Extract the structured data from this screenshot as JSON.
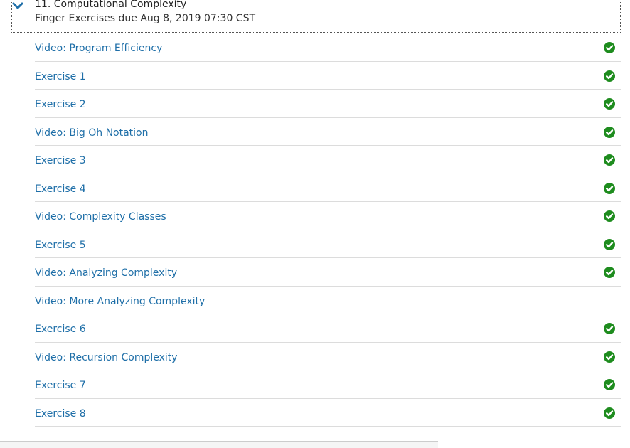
{
  "section": {
    "title": "11. Computational Complexity",
    "subtitle": "Finger Exercises due Aug 8, 2019 07:30 CST",
    "chevron_icon": "chevron-down-icon"
  },
  "items": [
    {
      "label": "Video: Program Efficiency",
      "completed": true
    },
    {
      "label": "Exercise 1",
      "completed": true
    },
    {
      "label": "Exercise 2",
      "completed": true
    },
    {
      "label": "Video: Big Oh Notation",
      "completed": true
    },
    {
      "label": "Exercise 3",
      "completed": true
    },
    {
      "label": "Exercise 4",
      "completed": true
    },
    {
      "label": "Video: Complexity Classes",
      "completed": true
    },
    {
      "label": "Exercise 5",
      "completed": true
    },
    {
      "label": "Video: Analyzing Complexity",
      "completed": true
    },
    {
      "label": "Video: More Analyzing Complexity",
      "completed": false
    },
    {
      "label": "Exercise 6",
      "completed": true
    },
    {
      "label": "Video: Recursion Complexity",
      "completed": true
    },
    {
      "label": "Exercise 7",
      "completed": true
    },
    {
      "label": "Exercise 8",
      "completed": true
    }
  ],
  "colors": {
    "link": "#1f6fa8",
    "check": "#1e8c1e",
    "chevron": "#1f6fa8"
  }
}
